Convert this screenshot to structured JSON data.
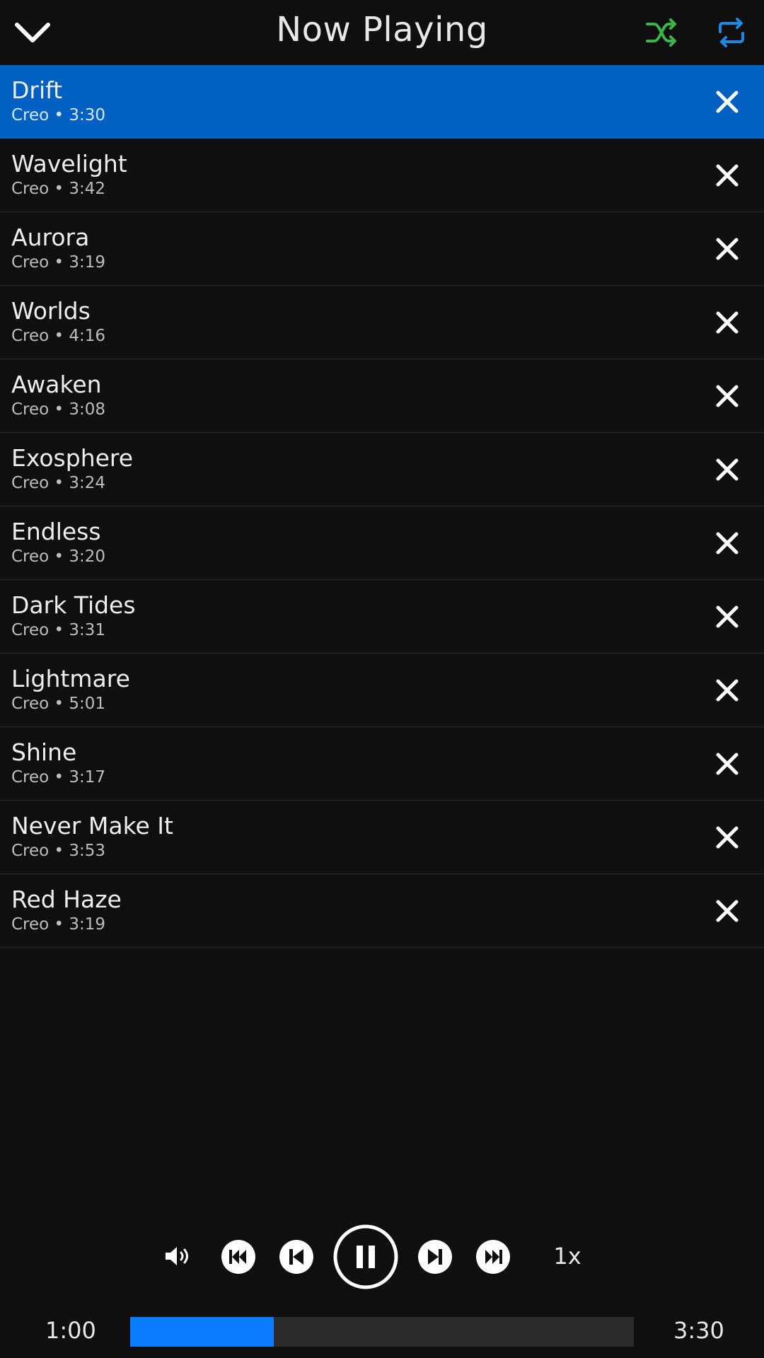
{
  "header": {
    "title": "Now Playing",
    "collapse_icon": "chevron-down-icon",
    "shuffle_icon": "shuffle-icon",
    "repeat_icon": "repeat-icon",
    "shuffle_color": "#3bb54a",
    "repeat_color": "#1e88e5"
  },
  "queue": [
    {
      "title": "Drift",
      "meta": "Creo • 3:30",
      "active": true
    },
    {
      "title": "Wavelight",
      "meta": "Creo • 3:42"
    },
    {
      "title": "Aurora",
      "meta": "Creo • 3:19"
    },
    {
      "title": "Worlds",
      "meta": "Creo • 4:16"
    },
    {
      "title": "Awaken",
      "meta": "Creo • 3:08"
    },
    {
      "title": "Exosphere",
      "meta": "Creo • 3:24"
    },
    {
      "title": "Endless",
      "meta": "Creo • 3:20"
    },
    {
      "title": "Dark Tides",
      "meta": "Creo • 3:31"
    },
    {
      "title": "Lightmare",
      "meta": "Creo • 5:01"
    },
    {
      "title": "Shine",
      "meta": "Creo • 3:17"
    },
    {
      "title": "Never Make It",
      "meta": "Creo • 3:53"
    },
    {
      "title": "Red Haze",
      "meta": "Creo • 3:19"
    }
  ],
  "colors": {
    "active_row": "#0061c2",
    "progress_fill": "#0a7cff",
    "progress_track": "#2b2b2b"
  },
  "controls": {
    "volume_icon": "volume-icon",
    "skip_to_start_icon": "skip-to-start-icon",
    "previous_icon": "previous-track-icon",
    "play_pause_icon": "pause-icon",
    "next_icon": "next-track-icon",
    "skip_to_end_icon": "skip-to-end-icon",
    "speed": "1x"
  },
  "progress": {
    "elapsed": "1:00",
    "total": "3:30",
    "fraction": 0.2857
  }
}
